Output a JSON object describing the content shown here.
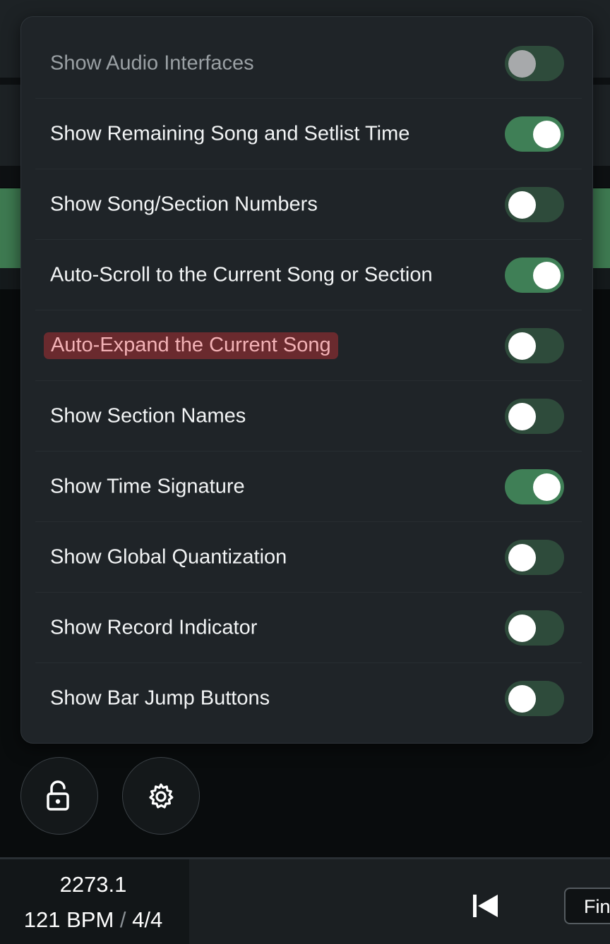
{
  "settings": [
    {
      "label": "Show Audio Interfaces",
      "state": "off",
      "disabled": true
    },
    {
      "label": "Show Remaining Song and Setlist Time",
      "state": "on"
    },
    {
      "label": "Show Song/Section Numbers",
      "state": "off"
    },
    {
      "label": "Auto-Scroll to the Current Song or Section",
      "state": "on"
    },
    {
      "label": "Auto-Expand the Current Song",
      "state": "off",
      "highlighted": true
    },
    {
      "label": "Show Section Names",
      "state": "off"
    },
    {
      "label": "Show Time Signature",
      "state": "on"
    },
    {
      "label": "Show Global Quantization",
      "state": "off"
    },
    {
      "label": "Show Record Indicator",
      "state": "off"
    },
    {
      "label": "Show Bar Jump Buttons",
      "state": "off"
    }
  ],
  "icons": {
    "lock": "unlock-icon",
    "settings": "gear-icon",
    "skip": "skip-to-start-icon"
  },
  "transport": {
    "position": "2273.1",
    "bpm": "121 BPM",
    "separator": "/",
    "time_signature": "4/4",
    "find_label": "Fin"
  },
  "colors": {
    "toggle_on": "#3f7f56",
    "toggle_off": "#2e4b3b",
    "highlight_bg": "#6a2a2e",
    "highlight_text": "#f3b2b6",
    "popover_bg": "#1f2428"
  }
}
